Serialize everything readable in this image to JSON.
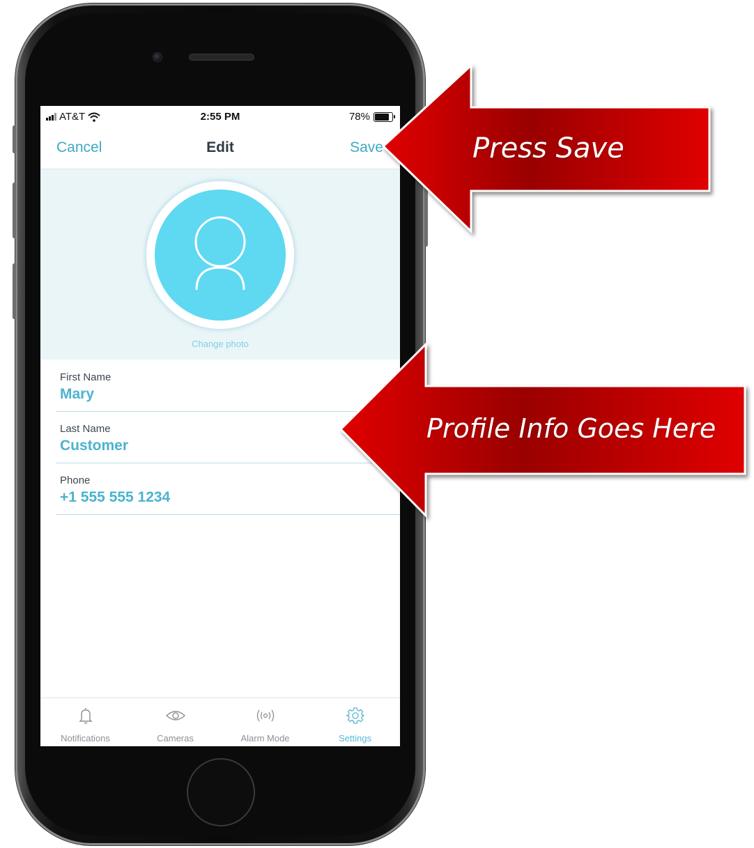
{
  "status_bar": {
    "carrier": "AT&T",
    "time": "2:55 PM",
    "battery_percent": "78%",
    "battery_level": 0.78
  },
  "nav": {
    "cancel_label": "Cancel",
    "title": "Edit",
    "save_label": "Save"
  },
  "profile": {
    "change_photo_label": "Change photo",
    "fields": [
      {
        "label": "First Name",
        "value": "Mary"
      },
      {
        "label": "Last Name",
        "value": "Customer"
      },
      {
        "label": "Phone",
        "value": "+1 555 555 1234"
      }
    ]
  },
  "tab_bar": {
    "tabs": [
      {
        "label": "Notifications",
        "icon": "bell-icon"
      },
      {
        "label": "Cameras",
        "icon": "eye-icon"
      },
      {
        "label": "Alarm Mode",
        "icon": "broadcast-icon"
      },
      {
        "label": "Settings",
        "icon": "gear-icon",
        "active": true
      }
    ]
  },
  "callouts": {
    "save_callout": "Press Save",
    "profile_callout": "Profile Info Goes Here",
    "color": "#e00000"
  },
  "colors": {
    "accent": "#3fa9c4",
    "avatar": "#5fd8f2",
    "photo_background": "#eaf5f8"
  }
}
